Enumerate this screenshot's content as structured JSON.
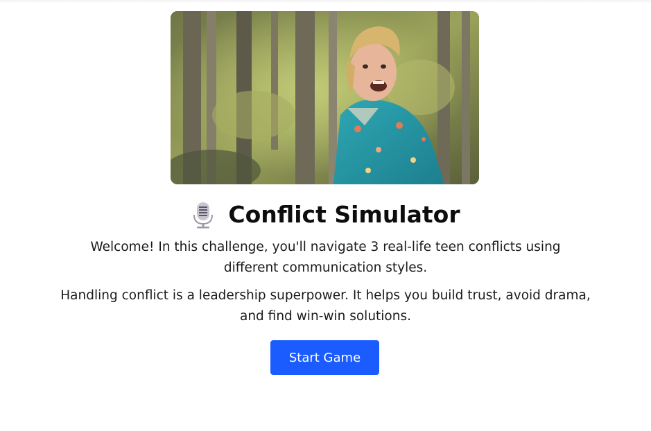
{
  "hero": {
    "image_description_icon": "forest-man-photo"
  },
  "header": {
    "icon": "microphone-icon",
    "title": "Conflict Simulator"
  },
  "intro": {
    "paragraph_1": "Welcome! In this challenge, you'll navigate 3 real-life teen conflicts using different communication styles.",
    "paragraph_2": "Handling conflict is a leadership superpower. It helps you build trust, avoid drama, and find win-win solutions."
  },
  "actions": {
    "start_label": "Start Game"
  },
  "colors": {
    "button": "#1b5cff",
    "button_text": "#ffffff",
    "text": "#1a1a1a"
  }
}
